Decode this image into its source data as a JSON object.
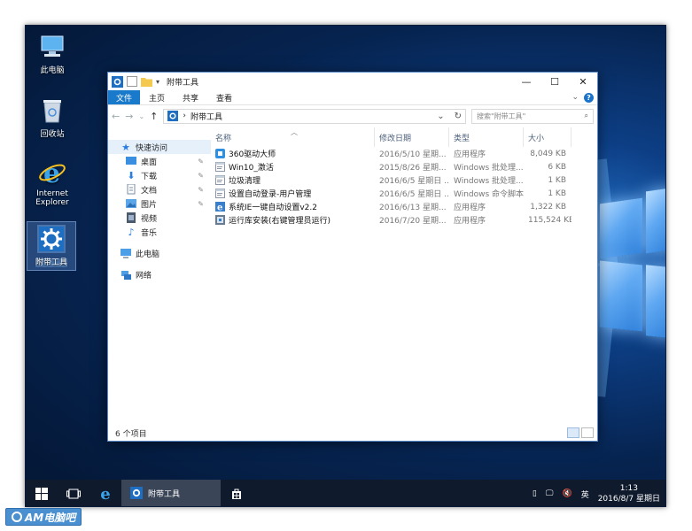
{
  "desktop": {
    "icons": [
      {
        "label": "此电脑"
      },
      {
        "label": "回收站"
      },
      {
        "label": "Internet Explorer"
      },
      {
        "label": "附带工具"
      }
    ]
  },
  "window": {
    "title": "附带工具",
    "controls": {
      "minimize": "—",
      "maximize": "☐",
      "close": "✕"
    },
    "ribbon_tabs": [
      "文件",
      "主页",
      "共享",
      "查看"
    ],
    "address": {
      "path": "附带工具",
      "separator": "›"
    },
    "search": {
      "placeholder": "搜索\"附带工具\""
    },
    "nav": {
      "quick_access": "快速访问",
      "items": [
        "桌面",
        "下载",
        "文档",
        "图片",
        "视频",
        "音乐"
      ],
      "this_pc": "此电脑",
      "network": "网络"
    },
    "columns": {
      "name": "名称",
      "date": "修改日期",
      "type": "类型",
      "size": "大小"
    },
    "files": [
      {
        "name": "360驱动大师",
        "date": "2016/5/10 星期...",
        "type": "应用程序",
        "size": "8,049 KB",
        "icon": "app-icon"
      },
      {
        "name": "Win10_激活",
        "date": "2015/8/26 星期...",
        "type": "Windows 批处理...",
        "size": "6 KB",
        "icon": "batch-icon"
      },
      {
        "name": "垃圾清理",
        "date": "2016/6/5 星期日 ...",
        "type": "Windows 批处理...",
        "size": "1 KB",
        "icon": "batch-icon"
      },
      {
        "name": "设置自动登录-用户管理",
        "date": "2016/6/5 星期日 ...",
        "type": "Windows 命令脚本",
        "size": "1 KB",
        "icon": "batch-icon"
      },
      {
        "name": "系统IE一键自动设置v2.2",
        "date": "2016/6/13 星期...",
        "type": "应用程序",
        "size": "1,322 KB",
        "icon": "ie-app-icon"
      },
      {
        "name": "运行库安装(右键管理员运行)",
        "date": "2016/7/20 星期...",
        "type": "应用程序",
        "size": "115,524 KB",
        "icon": "installer-icon"
      }
    ],
    "status": "6 个项目"
  },
  "taskbar": {
    "active_app": "附带工具",
    "ime": "英",
    "time": "1:13",
    "date": "2016/8/7 星期日"
  },
  "watermark": "AM电脑吧"
}
